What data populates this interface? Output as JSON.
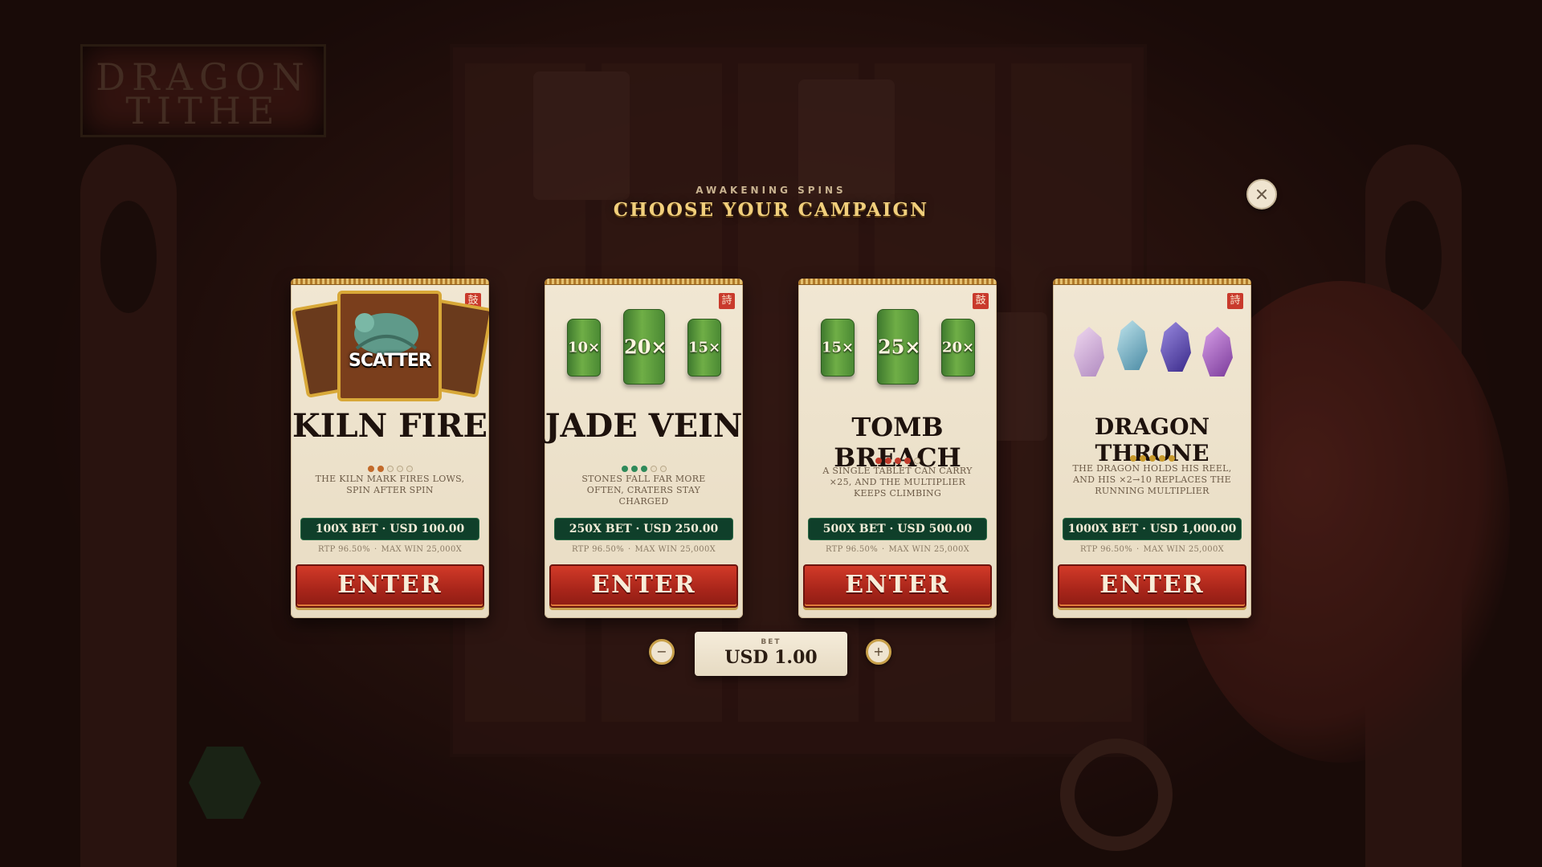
{
  "header": {
    "subtitle": "AWAKENING SPINS",
    "title": "CHOOSE YOUR CAMPAIGN"
  },
  "background": {
    "logo_line1": "DRAGON",
    "logo_line2": "TITHE"
  },
  "cards": [
    {
      "name": "KILN FIRE",
      "seal": "鼓",
      "art": "scatter-cards",
      "art_label": "SCATTER",
      "volatility": 2,
      "volatility_color": "#c26a2a",
      "description": "THE KILN MARK FIRES LOWS, SPIN AFTER SPIN",
      "price": "100X BET · USD 100.00",
      "rtp": "RTP 96.50%",
      "max_win": "MAX WIN 25,000X",
      "enter_label": "ENTER"
    },
    {
      "name": "JADE VEIN",
      "seal": "詩",
      "art": "jade-tablets",
      "tablets": [
        "10×",
        "20×",
        "15×"
      ],
      "volatility": 3,
      "volatility_color": "#2f8a5a",
      "description": "STONES FALL FAR MORE OFTEN, CRATERS STAY CHARGED",
      "price": "250X BET · USD 250.00",
      "rtp": "RTP 96.50%",
      "max_win": "MAX WIN 25,000X",
      "enter_label": "ENTER"
    },
    {
      "name": "TOMB BREACH",
      "seal": "鼓",
      "art": "jade-tablets",
      "tablets": [
        "15×",
        "25×",
        "20×"
      ],
      "volatility": 4,
      "volatility_color": "#c03a2a",
      "description": "A SINGLE TABLET CAN CARRY ×25, AND THE MULTIPLIER KEEPS CLIMBING",
      "price": "500X BET · USD 500.00",
      "rtp": "RTP 96.50%",
      "max_win": "MAX WIN 25,000X",
      "enter_label": "ENTER"
    },
    {
      "name": "DRAGON THRONE",
      "seal": "詩",
      "art": "crystals",
      "volatility": 5,
      "volatility_color": "#c99a2a",
      "description": "THE DRAGON HOLDS HIS REEL, AND HIS ×2→10 REPLACES THE RUNNING MULTIPLIER",
      "price": "1000X BET · USD 1,000.00",
      "rtp": "RTP 96.50%",
      "max_win": "MAX WIN 25,000X",
      "enter_label": "ENTER"
    }
  ],
  "bet": {
    "label": "BET",
    "value": "USD 1.00",
    "minus": "−",
    "plus": "+"
  },
  "colors": {
    "title_gold": "#f1cf7c",
    "enter_red": "#c2301f",
    "price_green": "#0f3f2a"
  }
}
